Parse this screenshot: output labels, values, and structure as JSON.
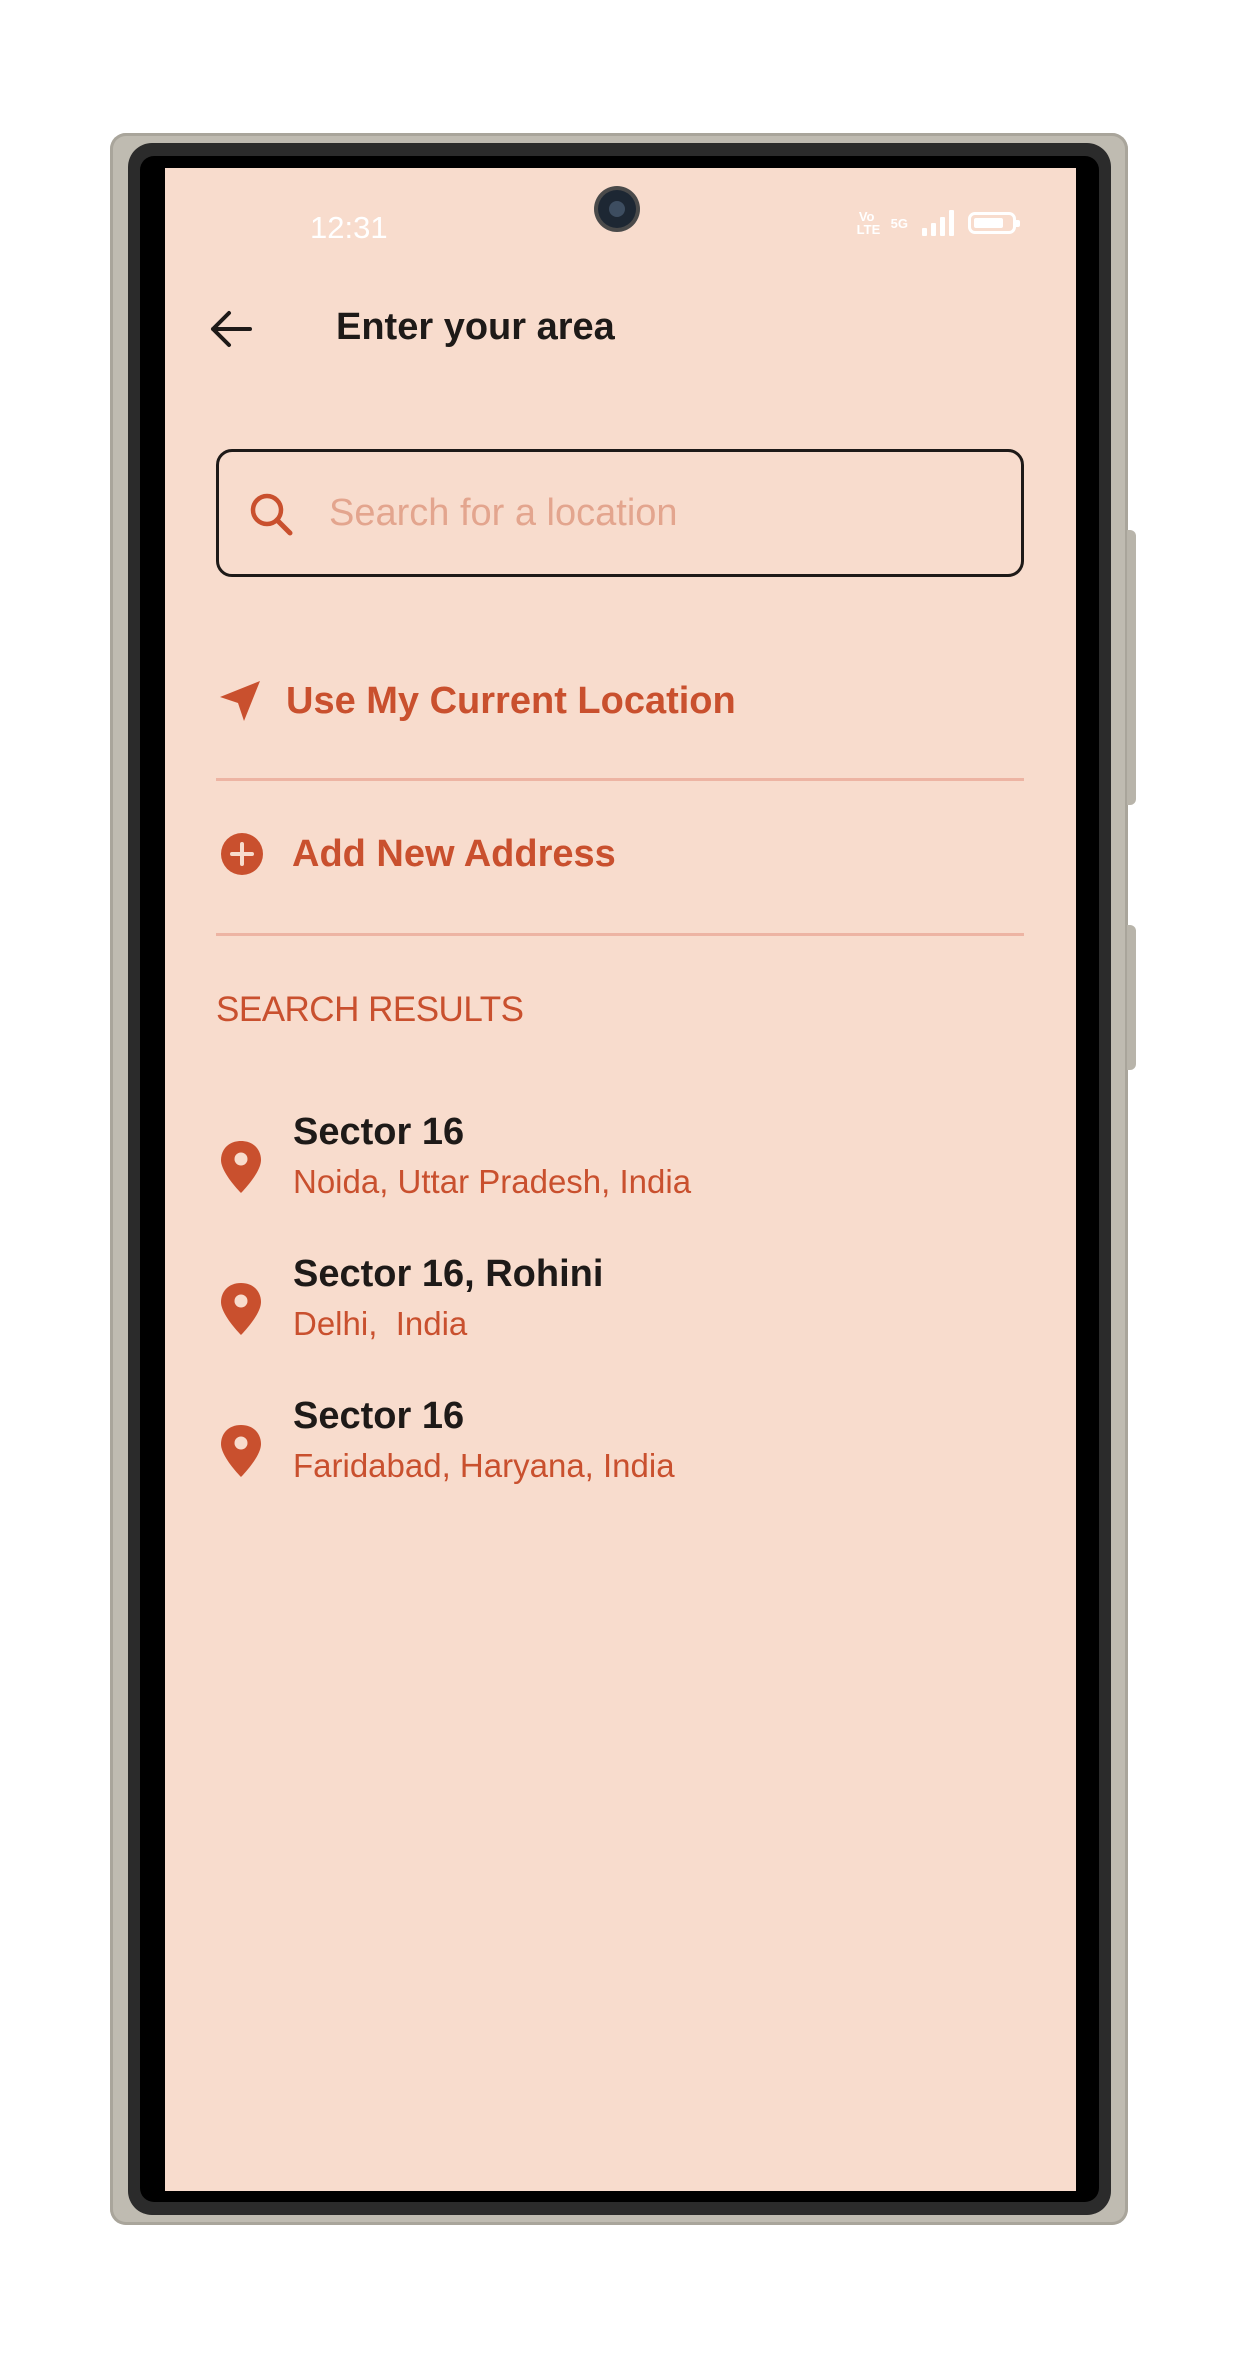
{
  "status_bar": {
    "time": "12:31",
    "volte_label": "Vo LTE",
    "network_label": "5G",
    "battery_level": 0.8
  },
  "header": {
    "title": "Enter your area"
  },
  "search": {
    "placeholder": "Search for a location",
    "value": ""
  },
  "actions": {
    "current_location_label": "Use My Current Location",
    "add_address_label": "Add New Address"
  },
  "results": {
    "heading": "SEARCH RESULTS",
    "items": [
      {
        "title": "Sector 16",
        "subtitle": "Noida, Uttar Pradesh, India"
      },
      {
        "title": "Sector 16, Rohini",
        "subtitle": "Delhi,  India"
      },
      {
        "title": "Sector 16",
        "subtitle": "Faridabad, Haryana, India"
      }
    ]
  },
  "colors": {
    "background": "#f8dccd",
    "accent": "#c9502e",
    "text": "#1e1a18",
    "divider": "#edb4a3"
  },
  "icons": [
    "back-arrow-icon",
    "search-icon",
    "navigation-arrow-icon",
    "plus-circle-icon",
    "location-pin-icon",
    "signal-icon",
    "battery-icon"
  ]
}
